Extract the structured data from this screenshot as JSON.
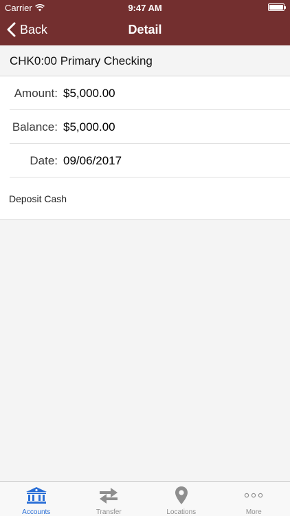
{
  "status_bar": {
    "carrier": "Carrier",
    "time": "9:47 AM"
  },
  "nav": {
    "back_label": "Back",
    "title": "Detail"
  },
  "account": {
    "header": "CHK0:00 Primary Checking"
  },
  "detail": {
    "rows": [
      {
        "label": "Amount:",
        "value": "$5,000.00"
      },
      {
        "label": "Balance:",
        "value": "$5,000.00"
      },
      {
        "label": "Date:",
        "value": "09/06/2017"
      }
    ],
    "description": "Deposit Cash"
  },
  "tabs": [
    {
      "label": "Accounts",
      "icon": "bank-icon",
      "active": true
    },
    {
      "label": "Transfer",
      "icon": "transfer-arrows-icon",
      "active": false
    },
    {
      "label": "Locations",
      "icon": "map-pin-icon",
      "active": false
    },
    {
      "label": "More",
      "icon": "more-dots-icon",
      "active": false
    }
  ],
  "colors": {
    "nav_background": "#732f2f",
    "active_tab": "#2a6fd6",
    "inactive_tab": "#8e8e8e"
  }
}
